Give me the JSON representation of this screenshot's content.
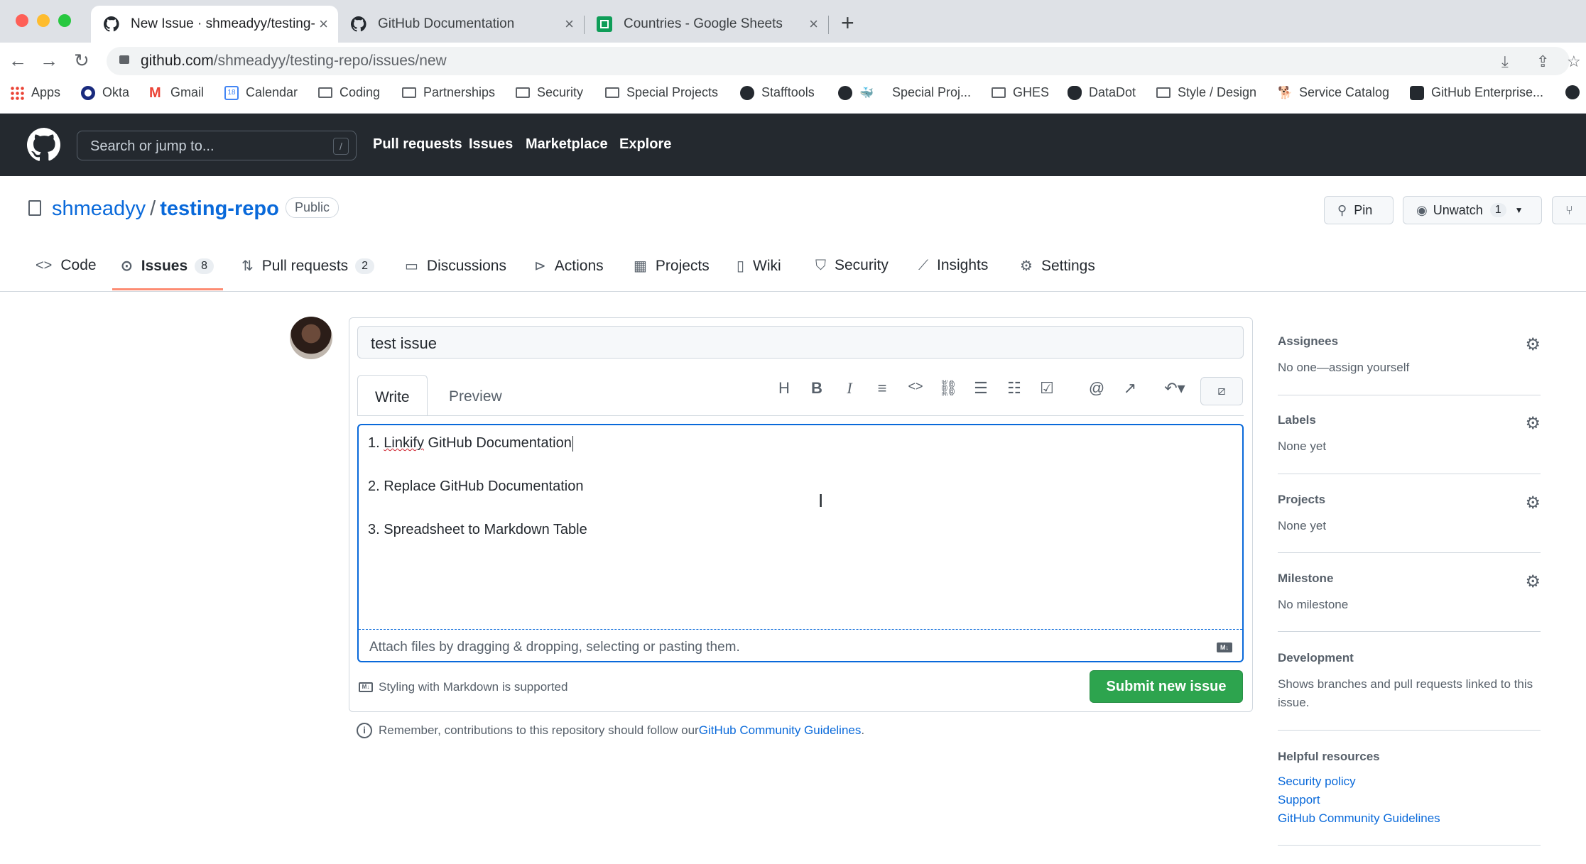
{
  "browser": {
    "tabs": [
      {
        "title": "New Issue · shmeadyy/testing-"
      },
      {
        "title": "GitHub Documentation"
      },
      {
        "title": "Countries - Google Sheets"
      }
    ],
    "url_host": "github.com",
    "url_path": "/shmeadyy/testing-repo/issues/new",
    "bookmarks": [
      "Apps",
      "Okta",
      "Gmail",
      "Calendar",
      "Coding",
      "Partnerships",
      "Security",
      "Special Projects",
      "Stafftools",
      "Special Proj...",
      "GHES",
      "DataDot",
      "Style / Design",
      "Service Catalog",
      "GitHub Enterprise..."
    ]
  },
  "header": {
    "search_placeholder": "Search or jump to...",
    "slash_key": "/",
    "nav": [
      "Pull requests",
      "Issues",
      "Marketplace",
      "Explore"
    ]
  },
  "repo": {
    "owner": "shmeadyy",
    "separator": "/",
    "name": "testing-repo",
    "visibility": "Public",
    "pin_label": "Pin",
    "unwatch_label": "Unwatch",
    "watch_count": "1",
    "tabs": [
      {
        "label": "Code"
      },
      {
        "label": "Issues",
        "count": "8"
      },
      {
        "label": "Pull requests",
        "count": "2"
      },
      {
        "label": "Discussions"
      },
      {
        "label": "Actions"
      },
      {
        "label": "Projects"
      },
      {
        "label": "Wiki"
      },
      {
        "label": "Security"
      },
      {
        "label": "Insights"
      },
      {
        "label": "Settings"
      }
    ]
  },
  "issue": {
    "title_value": "test issue",
    "write_tab": "Write",
    "preview_tab": "Preview",
    "body_lines": [
      {
        "prefix": "1. ",
        "misspelled": "Linkify",
        "rest": " GitHub Documentation"
      },
      {
        "text": "2. Replace GitHub Documentation"
      },
      {
        "text": "3. Spreadsheet to Markdown Table"
      }
    ],
    "attach_hint": "Attach files by dragging & dropping, selecting or pasting them.",
    "markdown_note": "Styling with Markdown is supported",
    "submit_label": "Submit new issue",
    "remember_text": "Remember, contributions to this repository should follow our ",
    "guidelines_link": "GitHub Community Guidelines",
    "remember_end": "."
  },
  "sidebar": {
    "assignees": {
      "heading": "Assignees",
      "value": "No one—assign yourself"
    },
    "labels": {
      "heading": "Labels",
      "value": "None yet"
    },
    "projects": {
      "heading": "Projects",
      "value": "None yet"
    },
    "milestone": {
      "heading": "Milestone",
      "value": "No milestone"
    },
    "development": {
      "heading": "Development",
      "value": "Shows branches and pull requests linked to this issue."
    },
    "helpful": {
      "heading": "Helpful resources",
      "links": [
        "Security policy",
        "Support",
        "GitHub Community Guidelines"
      ]
    }
  },
  "colors": {
    "accent": "#0969da",
    "submit": "#2da44e",
    "header_bg": "#24292f",
    "tab_underline": "#fd8c73"
  }
}
